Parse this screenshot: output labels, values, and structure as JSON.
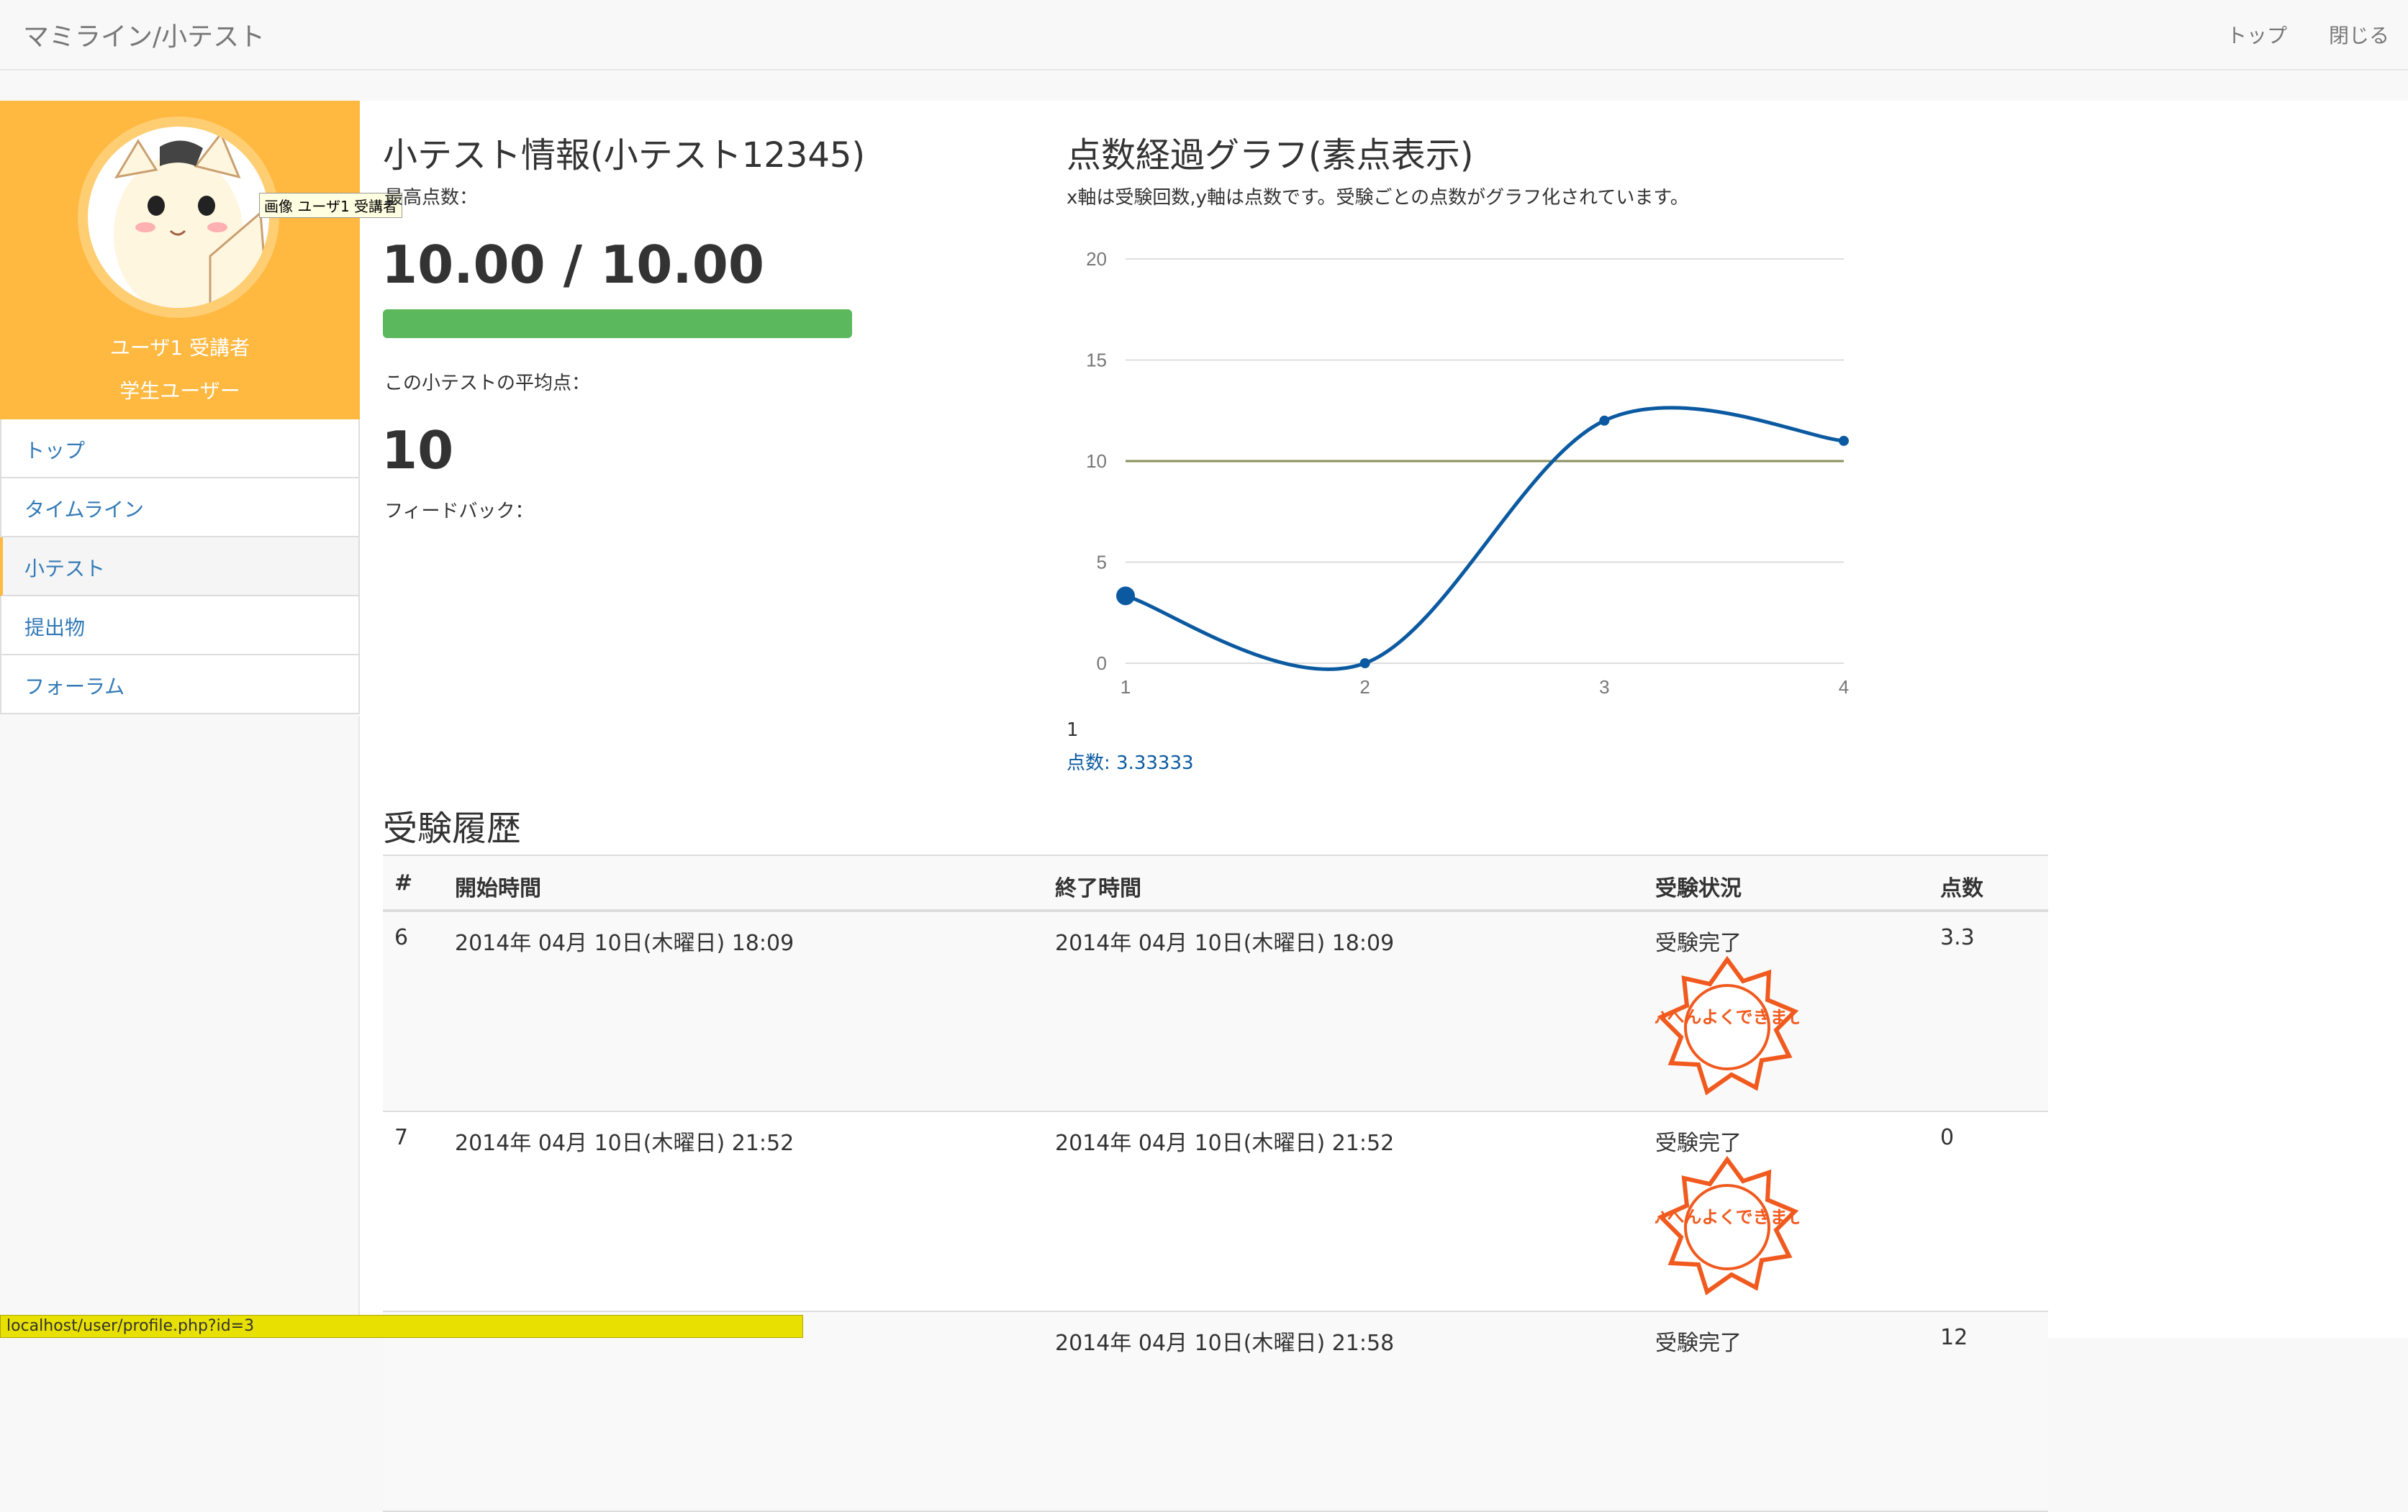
{
  "navbar": {
    "brand": "マミライン/小テスト",
    "links": [
      "トップ",
      "閉じる"
    ]
  },
  "sidebar": {
    "tooltip": "画像 ユーザ1 受講者",
    "user_name": "ユーザ1 受講者",
    "user_role": "学生ユーザー",
    "items": [
      {
        "label": "トップ"
      },
      {
        "label": "タイムライン"
      },
      {
        "label": "小テスト"
      },
      {
        "label": "提出物"
      },
      {
        "label": "フォーラム"
      }
    ]
  },
  "info": {
    "title": "小テスト情報(小テスト12345)",
    "best_label": "最高点数：",
    "best_score": "10.00 / 10.00",
    "best_fraction": 1.0,
    "avg_label": "この小テストの平均点：",
    "avg_value": "10",
    "feedback_label": "フィードバック："
  },
  "graph": {
    "title": "点数経過グラフ(素点表示)",
    "description": "x軸は受験回数,y軸は点数です。受験ごとの点数がグラフ化されています。",
    "tooltip_x": "1",
    "tooltip_text": "点数: 3.33333"
  },
  "chart_data": {
    "type": "line",
    "x": [
      1,
      2,
      3,
      4
    ],
    "series": [
      {
        "name": "点数",
        "values": [
          3.33333,
          0,
          12,
          11
        ],
        "color": "#0b5aa1"
      }
    ],
    "reference_line": {
      "value": 10,
      "color": "#8a8f5c"
    },
    "xlim": [
      1,
      4
    ],
    "ylim": [
      0,
      20
    ],
    "yticks": [
      0,
      5,
      10,
      15,
      20
    ],
    "xticks": [
      1,
      2,
      3,
      4
    ],
    "grid": true
  },
  "history": {
    "title": "受験履歴",
    "columns": [
      "#",
      "開始時間",
      "終了時間",
      "受験状況",
      "点数"
    ],
    "rows": [
      {
        "num": "6",
        "start": "2014年 04月 10日(木曜日) 18:09",
        "end": "2014年 04月 10日(木曜日) 18:09",
        "status": "受験完了",
        "score": "3.3",
        "stamp": "たいへんよくできました"
      },
      {
        "num": "7",
        "start": "2014年 04月 10日(木曜日) 21:52",
        "end": "2014年 04月 10日(木曜日) 21:52",
        "status": "受験完了",
        "score": "0",
        "stamp": "たいへんよくできました"
      },
      {
        "num": "",
        "start": "",
        "end": "2014年 04月 10日(木曜日) 21:58",
        "status": "受験完了",
        "score": "12",
        "stamp": ""
      }
    ]
  },
  "statusbar": {
    "url": "localhost/user/profile.php?id=3"
  },
  "colors": {
    "accent": "#ffb840",
    "link": "#337ab7",
    "progress": "#5cb85c",
    "stamp": "#f05a1e"
  }
}
